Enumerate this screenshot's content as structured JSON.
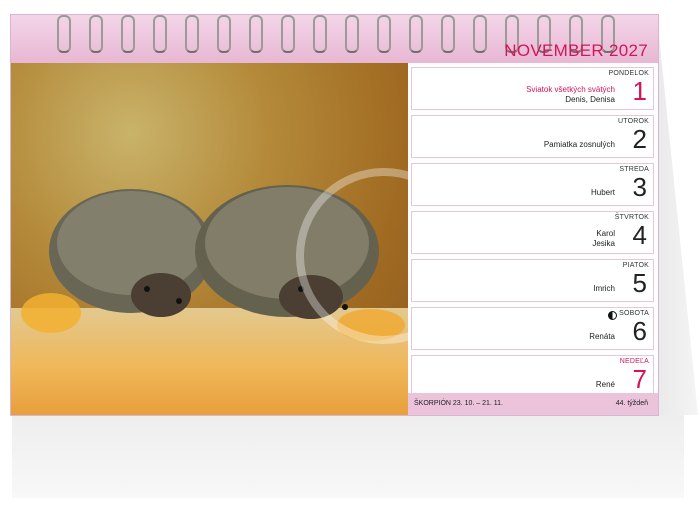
{
  "calendar": {
    "month_title": "NOVEMBER 2027",
    "days": [
      {
        "name": "PONDELOK",
        "number": "1",
        "holiday": "Sviatok všetkých svätých",
        "names": "Denis, Denisa"
      },
      {
        "name": "UTOROK",
        "number": "2",
        "names": "Pamiatka zosnulých"
      },
      {
        "name": "STREDA",
        "number": "3",
        "names": "Hubert"
      },
      {
        "name": "ŠTVRTOK",
        "number": "4",
        "names_line1": "Karol",
        "names_line2": "Jesika"
      },
      {
        "name": "PIATOK",
        "number": "5",
        "names": "Imrich"
      },
      {
        "name": "SOBOTA",
        "number": "6",
        "names": "Renáta"
      },
      {
        "name": "NEDEĽA",
        "number": "7",
        "names": "René"
      }
    ],
    "footer": {
      "zodiac": "ŠKORPIÓN 23. 10. – 21. 11.",
      "week": "44. týždeň"
    },
    "accent_color": "#d4145a",
    "header_color": "#e8b7d3"
  }
}
